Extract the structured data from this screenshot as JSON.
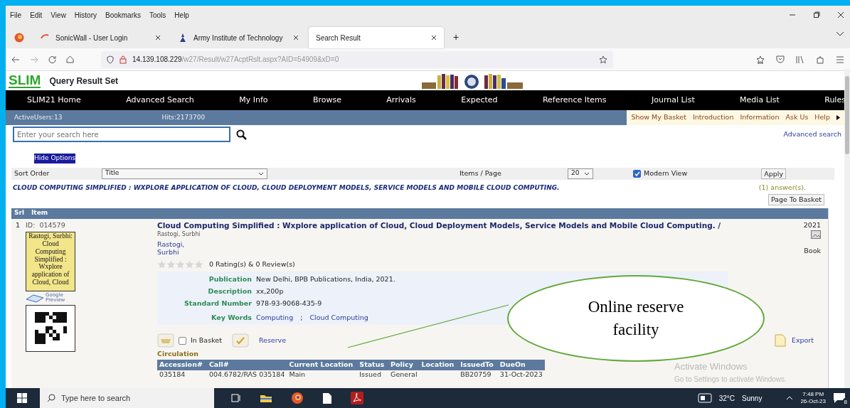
{
  "browser": {
    "menu": [
      "File",
      "Edit",
      "View",
      "History",
      "Bookmarks",
      "Tools",
      "Help"
    ],
    "tabs": [
      {
        "label": "SonicWall - User Login",
        "selected": false
      },
      {
        "label": "Army Institute of Technology",
        "selected": false
      },
      {
        "label": "Search Result",
        "selected": true
      }
    ],
    "new_tab": "+",
    "url_host": "14.139.108.229",
    "url_path": "/w27/Result/w27AcptRslt.aspx?AID=54909&xD=0"
  },
  "site": {
    "logo": "SLIM",
    "page_title": "Query Result Set",
    "nav": [
      "SLIM21 Home",
      "Advanced Search",
      "My Info",
      "Browse",
      "Arrivals",
      "Expected",
      "Reference Items",
      "Journal List",
      "Media List",
      "Rules"
    ],
    "active_users": "ActiveUsers:13",
    "hits": "Hits:2173700",
    "links": [
      "Show My Basket",
      "Introduction",
      "Information",
      "Ask Us",
      "Help"
    ],
    "search_placeholder": "Enter your search here",
    "advanced_search": "Advanced search"
  },
  "options": {
    "hide_options": "Hide Options",
    "sort_label": "Sort Order",
    "sort_value": "Title",
    "items_label": "Items / Page",
    "items_value": "20",
    "modern_view": {
      "label": "Modern View",
      "checked": true
    },
    "apply": "Apply"
  },
  "query": "CLOUD COMPUTING SIMPLIFIED : WXPLORE APPLICATION OF CLOUD, CLOUD DEPLOYMENT MODELS, SERVICE MODELS AND MOBILE CLOUD COMPUTING.",
  "answers": "(1) answer(s).",
  "page_to_basket": "Page To Basket",
  "results": {
    "columns": [
      "Srl",
      "Item"
    ],
    "items": [
      {
        "srl": "1",
        "id": "ID:  014579",
        "cover_text": "Rastogi, Surbhi: Cloud Computing Simplified : Wxplore application of Cloud, Cloud",
        "preview": [
          "Google",
          "Preview"
        ],
        "title": "Cloud Computing Simplified : Wxplore application of Cloud, Cloud Deployment Models, Service Models and Mobile Cloud Computing. /",
        "responsibility": "Rastogi, Surbhi",
        "author": [
          "Rastogi,",
          "Surbhi"
        ],
        "stars": 0,
        "rating_text": "0 Rating(s) & 0 Review(s)",
        "details": [
          {
            "label": "Publication",
            "value": "New Delhi, BPB Publications, India, 2021."
          },
          {
            "label": "Description",
            "value": "xx,200p"
          },
          {
            "label": "Standard Number",
            "value": "978-93-9068-435-9"
          }
        ],
        "keywords_label": "Key Words",
        "keywords": [
          "Computing",
          "Cloud Computing"
        ],
        "keyword_separator": ";",
        "in_basket": {
          "label": "In Basket",
          "checked": false
        },
        "reserve": "Reserve",
        "year": "2021",
        "type": "Book",
        "export": "Export",
        "circulation": {
          "title": "Circulation",
          "columns": [
            "Accession#",
            "Call#",
            "Current Location",
            "Status",
            "Policy",
            "Location",
            "IssuedTo",
            "DueOn"
          ],
          "rows": [
            {
              "accession": "035184",
              "call": "004.6782/RAS 035184",
              "current_location": "Main",
              "status": "Issued",
              "policy": "General",
              "issued_to": "BB20759",
              "due_on": "31-Oct-2023"
            }
          ]
        }
      }
    ]
  },
  "callout": "Online reserve facility",
  "os_notice": [
    "Activate Windows",
    "Go to Settings to activate Windows."
  ],
  "taskbar": {
    "search_placeholder": "Type here to search",
    "temperature": "32°C",
    "weather": "Sunny",
    "time": "7:48 PM",
    "date": "26-Oct-23",
    "notifications": "8"
  }
}
